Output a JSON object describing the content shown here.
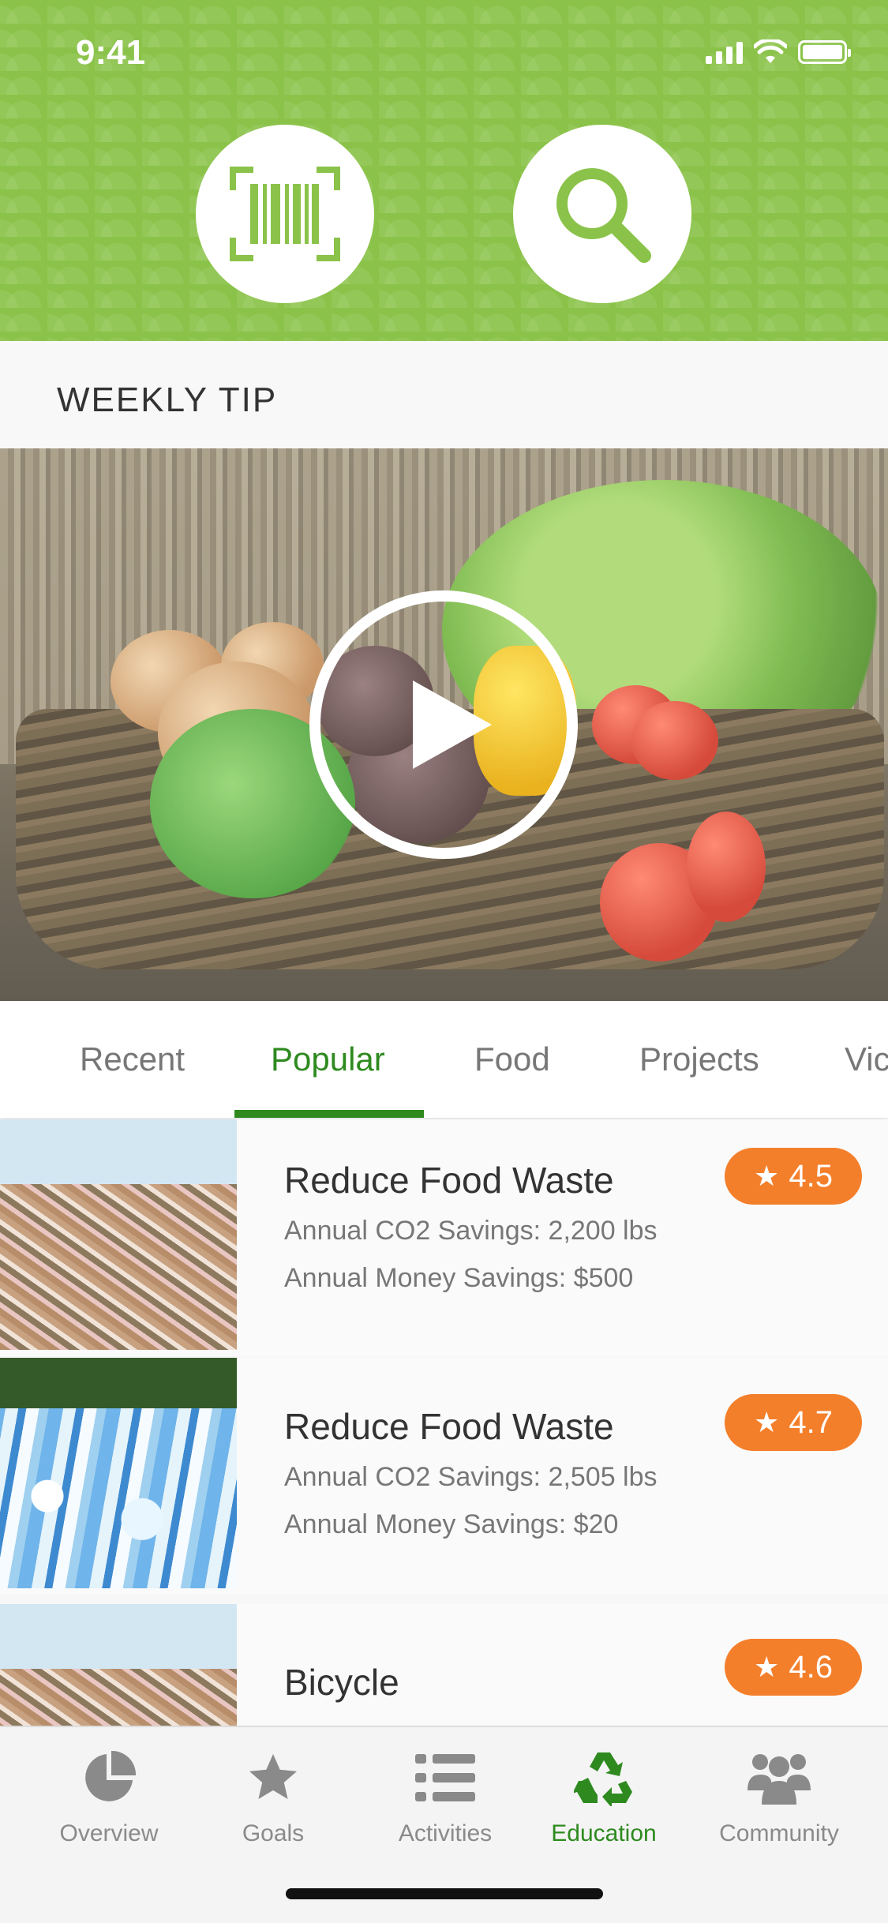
{
  "status_bar": {
    "time": "9:41"
  },
  "header": {
    "scan_button": {
      "icon": "barcode-scan-icon"
    },
    "search_button": {
      "icon": "magnifier-icon"
    },
    "accent_color": "#8bc34a"
  },
  "weekly_tip": {
    "title": "WEEKLY TIP",
    "media": "vegetable-basket-video"
  },
  "tabs": [
    {
      "label": "Recent"
    },
    {
      "label": "Popular",
      "active": true
    },
    {
      "label": "Food"
    },
    {
      "label": "Projects"
    },
    {
      "label": "Vic"
    }
  ],
  "items": [
    {
      "title": "Reduce Food Waste",
      "co2_label": "Annual CO2 Savings:",
      "co2_value": "2,200 lbs",
      "money_label": "Annual Money Savings:",
      "money_value": "$500",
      "rating": "4.5"
    },
    {
      "title": "Reduce Food Waste",
      "co2_label": "Annual CO2 Savings:",
      "co2_value": "2,505 lbs",
      "money_label": "Annual Money Savings:",
      "money_value": "$20",
      "rating": "4.7"
    },
    {
      "title": "Bicycle",
      "rating": "4.6"
    }
  ],
  "bottom_nav": [
    {
      "label": "Overview",
      "icon": "pie-chart-icon"
    },
    {
      "label": "Goals",
      "icon": "star-icon"
    },
    {
      "label": "Activities",
      "icon": "list-icon"
    },
    {
      "label": "Education",
      "icon": "recycle-icon",
      "active": true
    },
    {
      "label": "Community",
      "icon": "people-icon"
    }
  ],
  "colors": {
    "brand_green": "#2e8a1f",
    "rating_orange": "#f47f2b"
  }
}
